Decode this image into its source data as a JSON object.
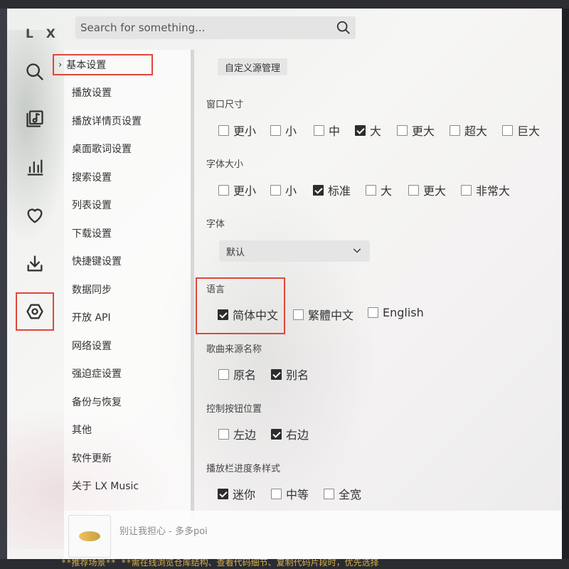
{
  "app": {
    "brand": "L X"
  },
  "search": {
    "placeholder": "Search for something..."
  },
  "nav": [
    {
      "icon": "search-icon"
    },
    {
      "icon": "music-library-icon"
    },
    {
      "icon": "leaderboard-icon"
    },
    {
      "icon": "heart-icon"
    },
    {
      "icon": "download-icon"
    },
    {
      "icon": "settings-icon",
      "active": true
    }
  ],
  "sidebar": {
    "items": [
      {
        "label": "基本设置",
        "active": true
      },
      {
        "label": "播放设置"
      },
      {
        "label": "播放详情页设置"
      },
      {
        "label": "桌面歌词设置"
      },
      {
        "label": "搜索设置"
      },
      {
        "label": "列表设置"
      },
      {
        "label": "下载设置"
      },
      {
        "label": "快捷键设置"
      },
      {
        "label": "数据同步"
      },
      {
        "label": "开放 API"
      },
      {
        "label": "网络设置"
      },
      {
        "label": "强迫症设置"
      },
      {
        "label": "备份与恢复"
      },
      {
        "label": "其他"
      },
      {
        "label": "软件更新"
      },
      {
        "label": "关于 LX Music"
      }
    ]
  },
  "main": {
    "source_button": "自定义源管理",
    "window_size": {
      "title": "窗口尺寸",
      "options": [
        {
          "label": "更小",
          "checked": false
        },
        {
          "label": "小",
          "checked": false
        },
        {
          "label": "中",
          "checked": false
        },
        {
          "label": "大",
          "checked": true
        },
        {
          "label": "更大",
          "checked": false
        },
        {
          "label": "超大",
          "checked": false
        },
        {
          "label": "巨大",
          "checked": false
        }
      ]
    },
    "font_size": {
      "title": "字体大小",
      "options": [
        {
          "label": "更小",
          "checked": false
        },
        {
          "label": "小",
          "checked": false
        },
        {
          "label": "标准",
          "checked": true
        },
        {
          "label": "大",
          "checked": false
        },
        {
          "label": "更大",
          "checked": false
        },
        {
          "label": "非常大",
          "checked": false
        }
      ]
    },
    "font": {
      "title": "字体",
      "value": "默认"
    },
    "language": {
      "title": "语言",
      "options": [
        {
          "label": "简体中文",
          "checked": true
        },
        {
          "label": "繁體中文",
          "checked": false
        },
        {
          "label": "English",
          "checked": false
        }
      ]
    },
    "source_name": {
      "title": "歌曲来源名称",
      "options": [
        {
          "label": "原名",
          "checked": false
        },
        {
          "label": "别名",
          "checked": true
        }
      ]
    },
    "control_position": {
      "title": "控制按钮位置",
      "options": [
        {
          "label": "左边",
          "checked": false
        },
        {
          "label": "右边",
          "checked": true
        }
      ]
    },
    "progress_style": {
      "title": "播放栏进度条样式",
      "options": [
        {
          "label": "迷你",
          "checked": true
        },
        {
          "label": "中等",
          "checked": false
        },
        {
          "label": "全宽",
          "checked": false
        }
      ]
    }
  },
  "player": {
    "track": "别让我担心 - 多多poi"
  },
  "background": {
    "code_text": "**推荐场景** **需在线浏览仓库结构、查看代码细节、复制代码片段时，优先选择"
  }
}
